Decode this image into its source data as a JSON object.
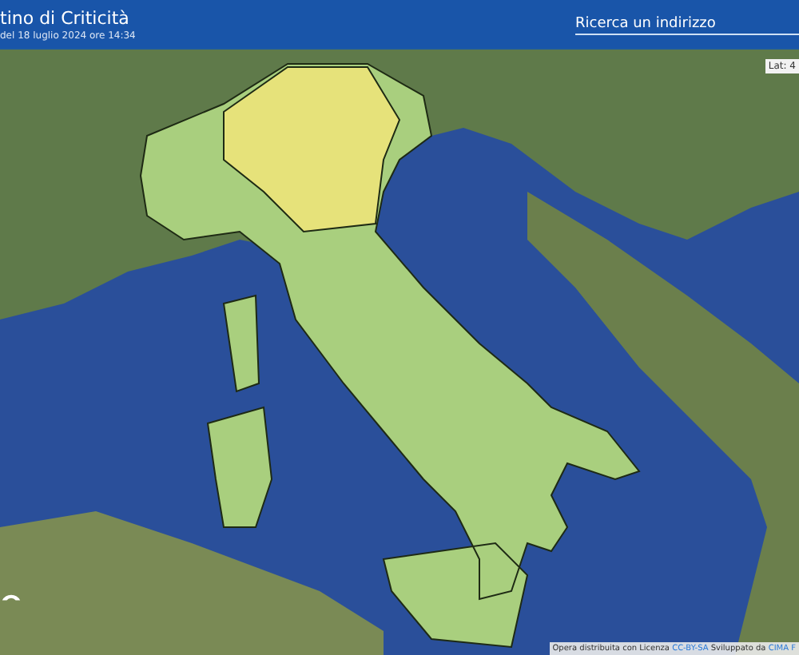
{
  "header": {
    "title": "tino di Criticità",
    "subtitle": "del 18 luglio 2024 ore 14:34"
  },
  "search": {
    "placeholder": "Ricerca un indirizzo"
  },
  "map": {
    "alert_areas": [
      {
        "color": "#a9cf7e"
      },
      {
        "color": "#e6e27a"
      }
    ]
  },
  "coordinates": "Lat: 4",
  "attribution": {
    "text": "Opera distribuita con Licenza ",
    "license_link": "CC-BY-SA",
    "credit": " Sviluppato da ",
    "credit_link": "CIMA F"
  }
}
